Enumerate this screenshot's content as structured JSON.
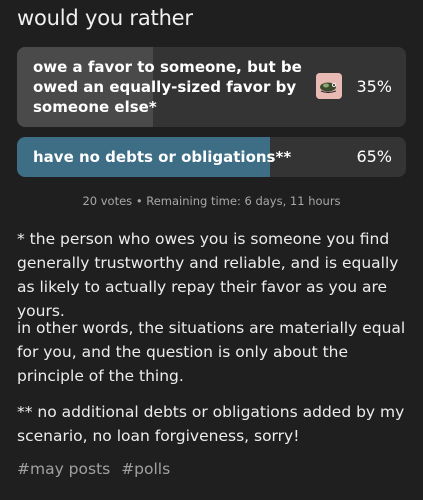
{
  "poll": {
    "title": "would you rather",
    "options": [
      {
        "label": "owe a favor to someone, but be owed an equally-sized favor by someone else*",
        "percent_label": "35%",
        "percent": 35,
        "fill_color": "#4a4a4a",
        "voter_avatar_icon": "user-avatar-icon"
      },
      {
        "label": "have no debts or obligations**",
        "percent_label": "65%",
        "percent": 65,
        "fill_color": "#3d6e85"
      }
    ],
    "meta": "20 votes • Remaining time: 6 days, 11 hours"
  },
  "body": {
    "paragraphs": [
      "* the person who owes you is someone you find generally trustworthy and reliable, and is equally as likely to actually repay their favor as you are yours.",
      "in other words, the situations are materially equal for you, and the question is only about the principle of the thing.",
      "** no additional debts or obligations added by my scenario, no loan forgiveness, sorry!"
    ]
  },
  "tags": [
    "#may posts",
    "#polls"
  ],
  "colors": {
    "background": "#1f1f1f",
    "option_bg": "#343434",
    "selected_fill": "#3d6e85",
    "meta_text": "#a8a8a8",
    "tag_text": "#a0a0a0"
  }
}
